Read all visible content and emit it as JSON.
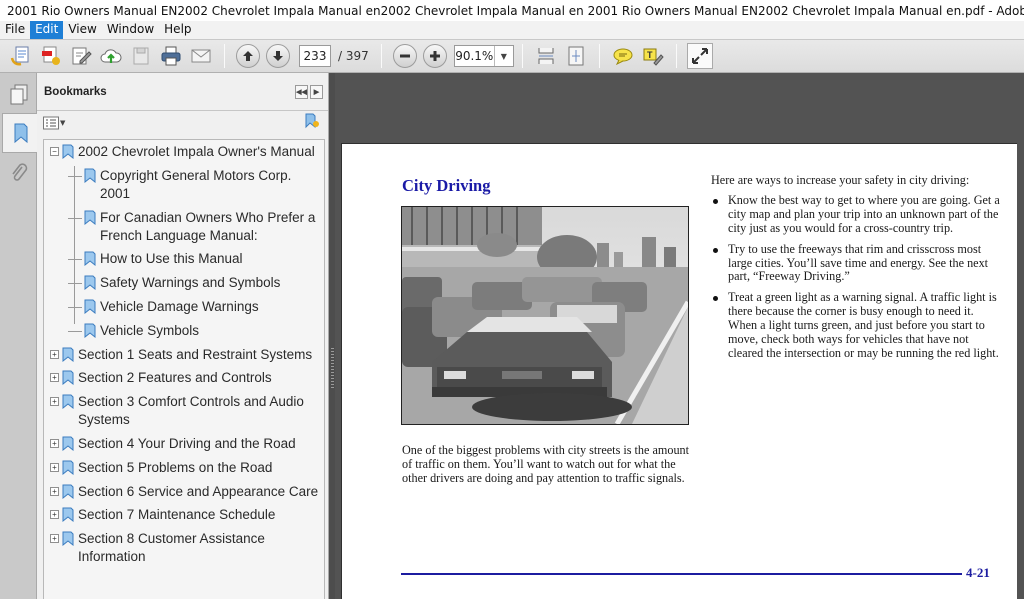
{
  "window": {
    "title": "2001 Rio Owners Manual EN2002 Chevrolet Impala Manual en2002 Chevrolet Impala Manual en 2001 Rio Owners Manual EN2002 Chevrolet Impala Manual en.pdf - Adobe Reader"
  },
  "menu": {
    "items": [
      {
        "label": "File",
        "active": false
      },
      {
        "label": "Edit",
        "active": true
      },
      {
        "label": "View",
        "active": false
      },
      {
        "label": "Window",
        "active": false
      },
      {
        "label": "Help",
        "active": false
      }
    ]
  },
  "toolbar": {
    "current_page": "233",
    "total_pages": "/ 397",
    "zoom": "90.1%",
    "icons": [
      "create-pdf-icon",
      "convert-pdf-icon",
      "sign-icon",
      "upload-cloud-icon",
      "save-icon",
      "print-icon",
      "email-icon",
      "previous-page-icon",
      "next-page-icon",
      "zoom-out-icon",
      "zoom-in-icon",
      "fit-width-icon",
      "fit-page-icon",
      "comment-icon",
      "highlight-text-icon",
      "full-screen-icon"
    ]
  },
  "sidebar": {
    "title": "Bookmarks",
    "bookmarks": [
      {
        "label": "2002 Chevrolet Impala Owner's Manual",
        "expander": "−",
        "children": [
          {
            "label": "Copyright General Motors Corp. 2001"
          },
          {
            "label": "For Canadian Owners Who Prefer a French Language Manual:"
          },
          {
            "label": "How to Use this Manual"
          },
          {
            "label": "Safety Warnings and Symbols"
          },
          {
            "label": "Vehicle Damage Warnings"
          },
          {
            "label": "Vehicle Symbols"
          }
        ]
      },
      {
        "label": "Section 1 Seats and Restraint Systems",
        "expander": "+"
      },
      {
        "label": "Section 2 Features and Controls",
        "expander": "+"
      },
      {
        "label": "Section 3 Comfort Controls and Audio Systems",
        "expander": "+"
      },
      {
        "label": "Section 4 Your Driving and the Road",
        "expander": "+"
      },
      {
        "label": "Section 5 Problems on the Road",
        "expander": "+"
      },
      {
        "label": "Section 6 Service and Appearance Care",
        "expander": "+"
      },
      {
        "label": "Section 7 Maintenance Schedule",
        "expander": "+"
      },
      {
        "label": "Section 8 Customer Assistance Information",
        "expander": "+"
      }
    ]
  },
  "document": {
    "heading": "City Driving",
    "image_alt": "Illustration of heavy city traffic with cars in lanes and tall buildings",
    "caption": "One of the biggest problems with city streets is the amount of traffic on them. You’ll want to watch out for what the other drivers are doing and pay attention to traffic signals.",
    "intro": "Here are ways to increase your safety in city driving:",
    "bullets": [
      "Know the best way to get to where you are going. Get a city map and plan your trip into an unknown part of the city just as you would for a cross-country trip.",
      "Try to use the freeways that rim and crisscross most large cities. You’ll save time and energy. See the next part, “Freeway Driving.”",
      "Treat a green light as a warning signal. A traffic light is there because the corner is busy enough to need it. When a light turns green, and just before you start to move, check both ways for vehicles that have not cleared the intersection or may be running the red light."
    ],
    "page_number": "4-21",
    "accent_color": "#1c1ca0"
  }
}
